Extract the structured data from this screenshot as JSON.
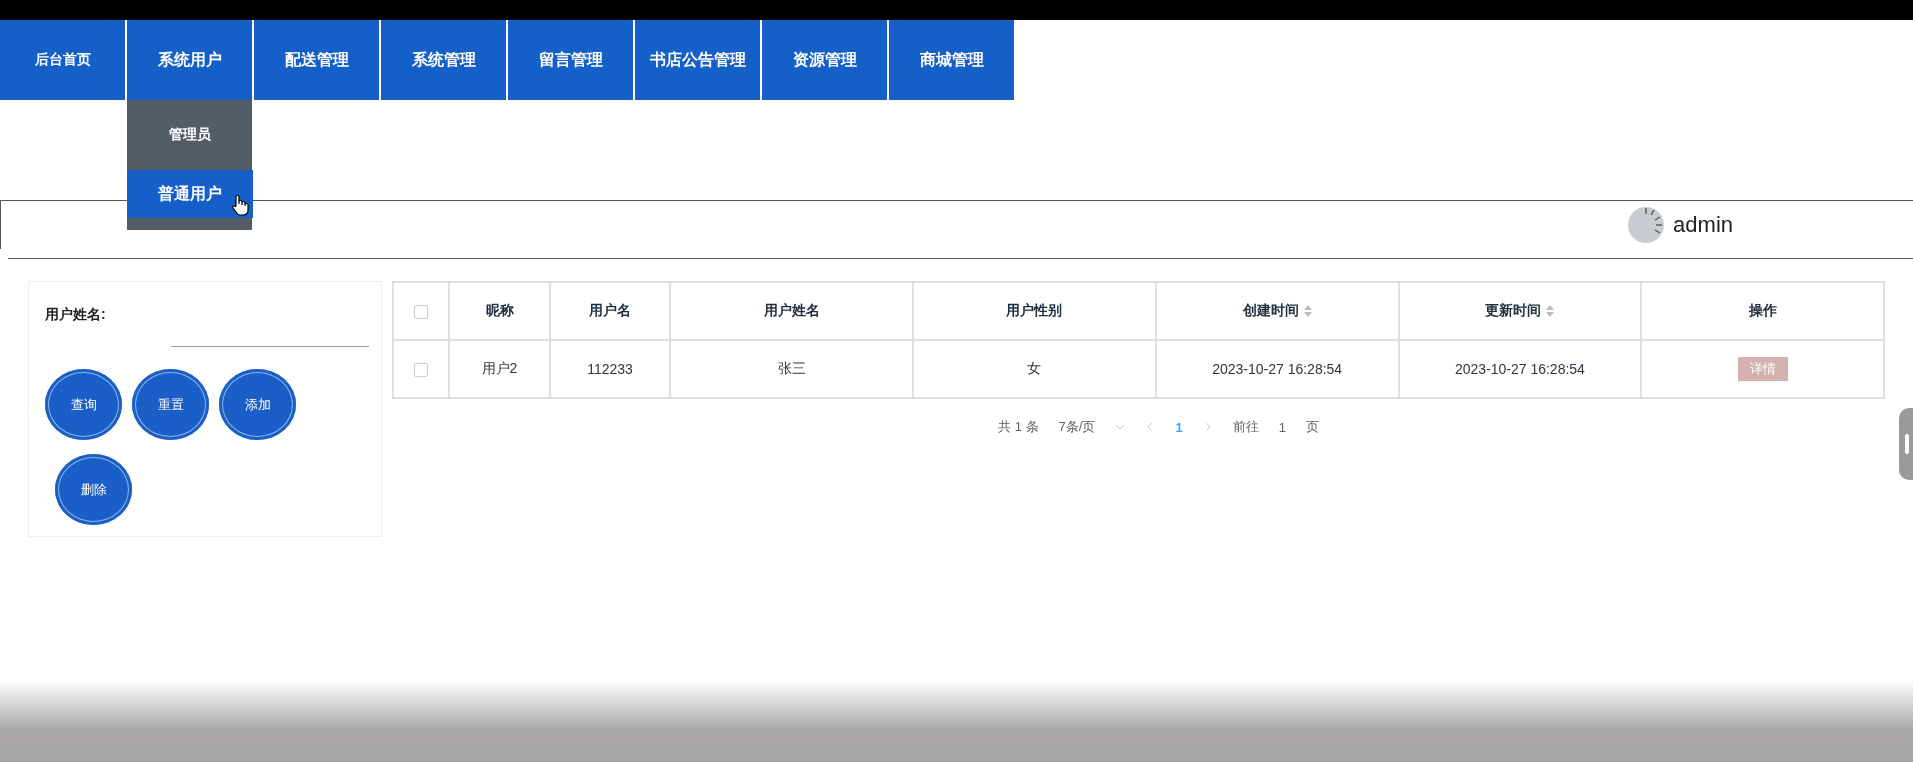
{
  "nav": {
    "items": [
      {
        "label": "后台首页"
      },
      {
        "label": "系统用户",
        "children": [
          {
            "label": "管理员",
            "selected": false
          },
          {
            "label": "普通用户",
            "selected": true
          }
        ]
      },
      {
        "label": "配送管理"
      },
      {
        "label": "系统管理"
      },
      {
        "label": "留言管理"
      },
      {
        "label": "书店公告管理"
      },
      {
        "label": "资源管理"
      },
      {
        "label": "商城管理"
      }
    ]
  },
  "header": {
    "username": "admin"
  },
  "search": {
    "label": "用户姓名:",
    "buttons": [
      "查询",
      "重置",
      "添加",
      "删除"
    ]
  },
  "table": {
    "header_checked": false,
    "columns": [
      {
        "label": "昵称",
        "sortable": false
      },
      {
        "label": "用户名",
        "sortable": false
      },
      {
        "label": "用户姓名",
        "sortable": false
      },
      {
        "label": "用户性别",
        "sortable": false
      },
      {
        "label": "创建时间",
        "sortable": true
      },
      {
        "label": "更新时间",
        "sortable": true
      },
      {
        "label": "操作",
        "sortable": false
      }
    ],
    "rows": [
      {
        "checked": false,
        "cells": [
          "用户2",
          "112233",
          "张三",
          "女",
          "2023-10-27 16:28:54",
          "2023-10-27 16:28:54"
        ],
        "action": "详情"
      }
    ]
  },
  "pagination": {
    "total": "共 1 条",
    "page_size": "7条/页",
    "pages": [
      {
        "label": "1",
        "selected": true
      }
    ],
    "goto_label": "前往",
    "goto_value": "1",
    "page_suffix": "页"
  }
}
